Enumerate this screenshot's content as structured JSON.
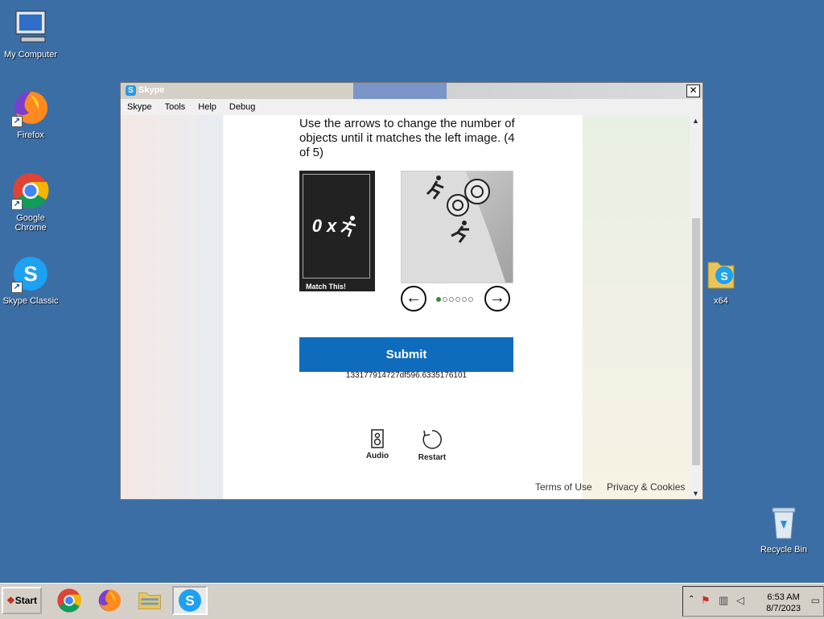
{
  "desktop": {
    "icons": [
      {
        "label": "My Computer",
        "icon": "computer-icon"
      },
      {
        "label": "Firefox",
        "icon": "firefox-icon"
      },
      {
        "label": "Google Chrome",
        "icon": "chrome-icon"
      },
      {
        "label": "Skype Classic",
        "icon": "skype-icon"
      },
      {
        "label": "x64",
        "icon": "folder-skype-icon"
      },
      {
        "label": "Recycle Bin",
        "icon": "recycle-bin-icon"
      }
    ]
  },
  "window": {
    "title": "Skype",
    "close_label": "✕",
    "menu": [
      "Skype",
      "Tools",
      "Help",
      "Debug"
    ]
  },
  "captcha": {
    "instruction": "Use the arrows to change the number of objects until it matches the left image. (4 of 5)",
    "left_image_text": "0 x",
    "left_image_caption": "Match This!",
    "prev_label": "←",
    "next_label": "→",
    "page_dots_total": 6,
    "page_dots_active": 1,
    "submit_label": "Submit",
    "token": "133177914727df596.6335176101",
    "audio_label": "Audio",
    "restart_label": "Restart"
  },
  "footer": {
    "terms": "Terms of Use",
    "privacy": "Privacy & Cookies"
  },
  "taskbar": {
    "start_label": "Start",
    "apps": [
      "chrome-icon",
      "firefox-icon",
      "file-explorer-icon",
      "skype-icon"
    ],
    "clock_time": "6:53 AM",
    "clock_date": "8/7/2023"
  },
  "colors": {
    "desktop": "#3b6ea5",
    "submit": "#0f6cbd"
  }
}
